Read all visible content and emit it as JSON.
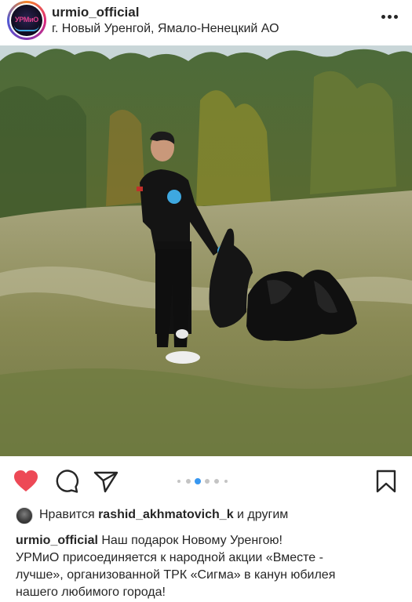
{
  "post": {
    "username": "urmio_official",
    "location": "г. Новый Уренгой, Ямало-Ненецкий АО",
    "avatar_logo_text": "УРМиО",
    "menu_icon": "more-horizontal-icon"
  },
  "actions": {
    "like_icon": "heart-filled-icon",
    "comment_icon": "comment-icon",
    "share_icon": "send-icon",
    "save_icon": "bookmark-icon",
    "like_color": "#ed4956"
  },
  "carousel": {
    "total": 6,
    "active_index": 2
  },
  "likes": {
    "prefix": "Нравится",
    "user": "rashid_akhmatovich_k",
    "suffix": "и другим"
  },
  "caption": {
    "username": "urmio_official",
    "line1": "Наш подарок Новому Уренгою!",
    "line2": "УРМиО присоединяется к народной акции «Вместе -",
    "line3": "лучше», организованной ТРК «Сигма» в канун юбилея",
    "line4": "нашего любимого города!"
  }
}
